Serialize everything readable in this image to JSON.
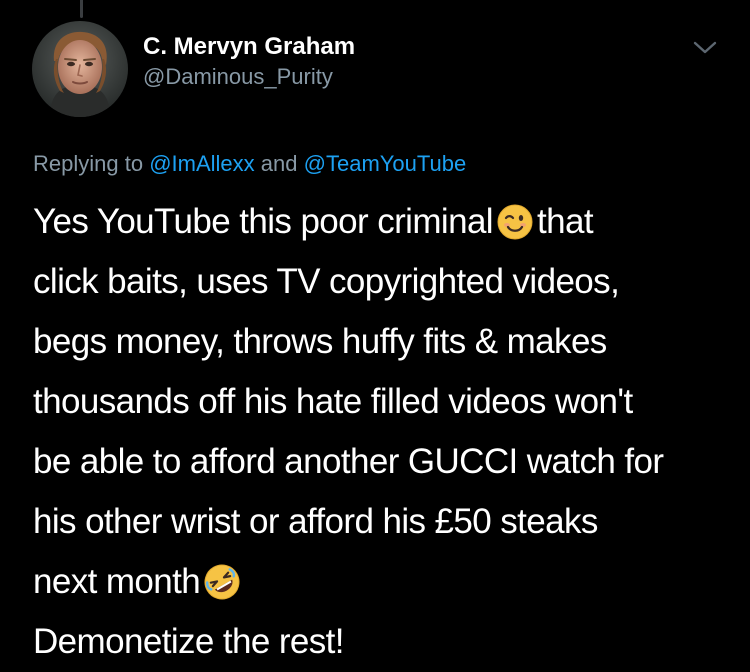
{
  "tweet": {
    "author": {
      "display_name": "C. Mervyn Graham",
      "handle": "@Daminous_Purity"
    },
    "reply_context": {
      "prefix": "Replying to",
      "mention_1": "@ImAllexx",
      "connector": "and",
      "mention_2": "@TeamYouTube"
    },
    "body": {
      "line_1_a": "Yes YouTube this poor criminal",
      "line_1_b": "that",
      "line_2": "click baits, uses TV copyrighted videos,",
      "line_3": "begs money, throws huffy fits & makes",
      "line_4": "thousands off his hate filled videos won't",
      "line_5": "be able to afford another GUCCI watch for",
      "line_6": "his other wrist or afford his £50 steaks",
      "line_7": "next month",
      "line_8": "Demonetize the rest!"
    },
    "emojis": {
      "first": "winking-face-emoji",
      "second": "rolling-on-floor-laughing-emoji"
    },
    "menu_icon": "chevron-down-icon"
  },
  "colors": {
    "background": "#000000",
    "text_primary": "#ffffff",
    "text_secondary": "#8899a6",
    "link": "#1da1f2",
    "thread_line": "#3a3d40",
    "emoji_yellow": "#f6c344"
  }
}
